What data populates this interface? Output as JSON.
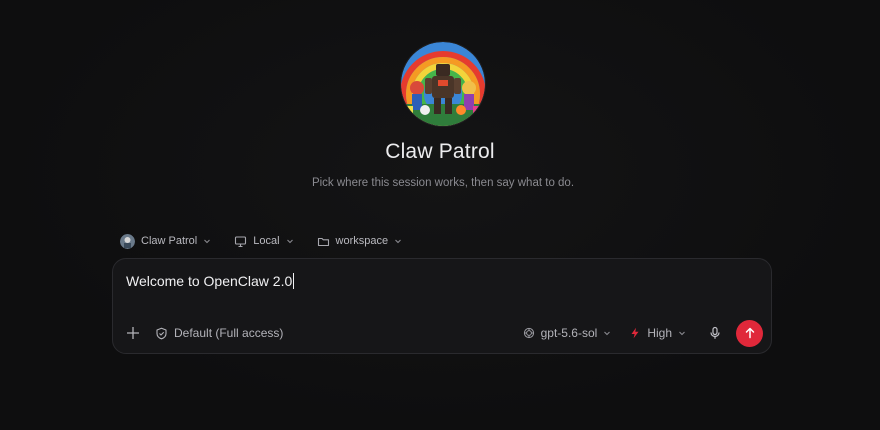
{
  "agent": {
    "name": "Claw Patrol",
    "avatar_icon": "claw-patrol-avatar"
  },
  "header": {
    "title": "Claw Patrol",
    "subtitle": "Pick where this session works, then say what to do."
  },
  "selectors": {
    "agent_label": "Claw Patrol",
    "environment_label": "Local",
    "folder_label": "workspace"
  },
  "composer": {
    "text": "Welcome to OpenClaw 2.0",
    "access_label": "Default (Full access)",
    "model_label": "gpt-5.6-sol",
    "effort_label": "High"
  },
  "colors": {
    "background": "#0f0f10",
    "composer_bg": "#161618",
    "send_button": "#e0283a",
    "effort_accent": "#e0283a"
  }
}
